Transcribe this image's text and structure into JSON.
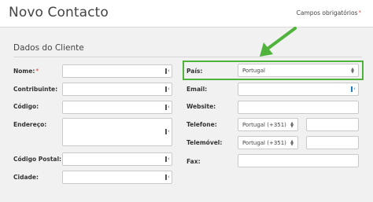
{
  "header": {
    "title": "Novo Contacto",
    "required_note": "Campos obrigatórios",
    "required_mark": "*"
  },
  "section_title": "Dados do Cliente",
  "left_fields": {
    "nome": "Nome:",
    "contribuinte": "Contribuinte:",
    "codigo": "Código:",
    "endereco": "Endereço:",
    "codigo_postal": "Código Postal:",
    "cidade": "Cidade:"
  },
  "right_fields": {
    "pais": "País:",
    "pais_value": "Portugal",
    "email": "Email:",
    "website": "Website:",
    "telefone": "Telefone:",
    "telefone_code": "Portugal (+351)",
    "telemovel": "Telemóvel:",
    "telemovel_code": "Portugal (+351)",
    "fax": "Fax:"
  },
  "colors": {
    "highlight": "#4fb33c",
    "required": "#e53935"
  },
  "icons": {
    "field_helper": "id-card-icon",
    "annotation": "green-arrow-icon"
  }
}
